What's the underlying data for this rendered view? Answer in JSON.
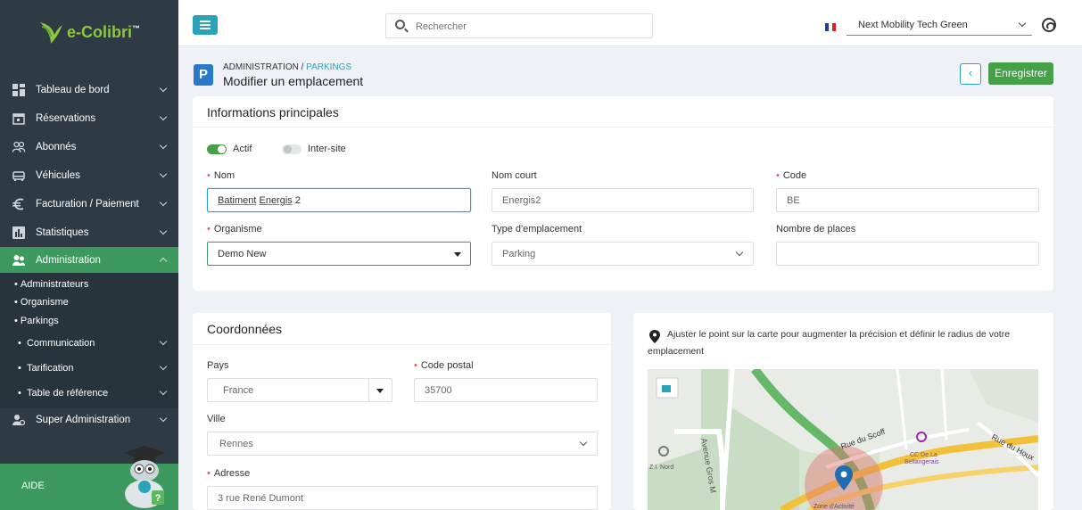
{
  "app": {
    "name": "e-Colibri",
    "tm": "™"
  },
  "sidebar": {
    "items": [
      {
        "label": "Tableau de bord",
        "icon": "dashboard-icon"
      },
      {
        "label": "Réservations",
        "icon": "calendar-icon"
      },
      {
        "label": "Abonnés",
        "icon": "users-icon"
      },
      {
        "label": "Véhicules",
        "icon": "car-icon"
      },
      {
        "label": "Facturation / Paiement",
        "icon": "euro-icon"
      },
      {
        "label": "Statistiques",
        "icon": "chart-icon"
      },
      {
        "label": "Administration",
        "icon": "admin-icon"
      }
    ],
    "subitems": [
      {
        "label": "Administrateurs"
      },
      {
        "label": "Organisme"
      },
      {
        "label": "Parkings"
      },
      {
        "label": "Communication"
      },
      {
        "label": "Tarification"
      },
      {
        "label": "Table de référence"
      }
    ],
    "super_admin": "Super Administration",
    "help": "AIDE"
  },
  "topbar": {
    "search_placeholder": "Rechercher",
    "organization": "Next Mobility Tech Green"
  },
  "header": {
    "badge": "P",
    "crumb_root": "ADMINISTRATION",
    "crumb_sep": " / ",
    "crumb_current": "PARKINGS",
    "title": "Modifier un emplacement",
    "back_symbol": "‹",
    "save_label": "Enregistrer"
  },
  "main_info": {
    "title": "Informations principales",
    "actif_label": "Actif",
    "actif_on": true,
    "intersite_label": "Inter-site",
    "intersite_on": false,
    "nom_label": "Nom",
    "nom_value_a": "Batiment",
    "nom_value_b": "Energis",
    "nom_value_c": "2",
    "nom_court_label": "Nom court",
    "nom_court_value": "Energis2",
    "code_label": "Code",
    "code_value": "BE",
    "organisme_label": "Organisme",
    "organisme_value": "Demo New",
    "type_label": "Type d'emplacement",
    "type_value": "Parking",
    "places_label": "Nombre de places",
    "places_value": ""
  },
  "coords": {
    "title": "Coordonnées",
    "pays_label": "Pays",
    "pays_value": "France",
    "cp_label": "Code postal",
    "cp_value": "35700",
    "ville_label": "Ville",
    "ville_value": "Rennes",
    "adresse_label": "Adresse",
    "adresse_value": "3 rue René Dumont"
  },
  "map": {
    "hint_line1": "Ajuster le point sur la carte pour augmenter la précision et définir le radius de votre",
    "hint_line2": "emplacement",
    "labels": {
      "avenue": "Avenue Gros M",
      "rue_scoff": "Rue du Scoff",
      "rue_houx": "Rue du Houx",
      "cc": "CC De La",
      "cc2": "Bellangerais",
      "zi": "Z.I. Nord",
      "zone": "Zone d'Activité"
    }
  },
  "colors": {
    "sidebar": "#2e3b44",
    "accent": "#2aa3b8",
    "green": "#45a049",
    "admin_active": "#3c9a5f"
  }
}
